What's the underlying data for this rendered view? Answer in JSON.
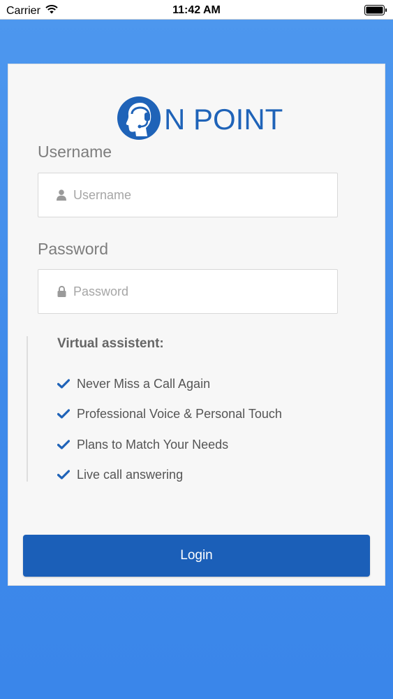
{
  "status_bar": {
    "carrier": "Carrier",
    "time": "11:42 AM"
  },
  "logo": {
    "text": "N POINT",
    "brand_color": "#1f63b8"
  },
  "login_form": {
    "username_label": "Username",
    "username_placeholder": "Username",
    "password_label": "Password",
    "password_placeholder": "Password"
  },
  "features": {
    "title": "Virtual assistent:",
    "items": [
      "Never Miss a Call Again",
      "Professional Voice & Personal Touch",
      "Plans to Match Your Needs",
      "Live call answering"
    ]
  },
  "login_button": {
    "label": "Login"
  },
  "colors": {
    "background": "#4d97ee",
    "accent": "#1b5fb8",
    "check": "#1f63b8"
  }
}
